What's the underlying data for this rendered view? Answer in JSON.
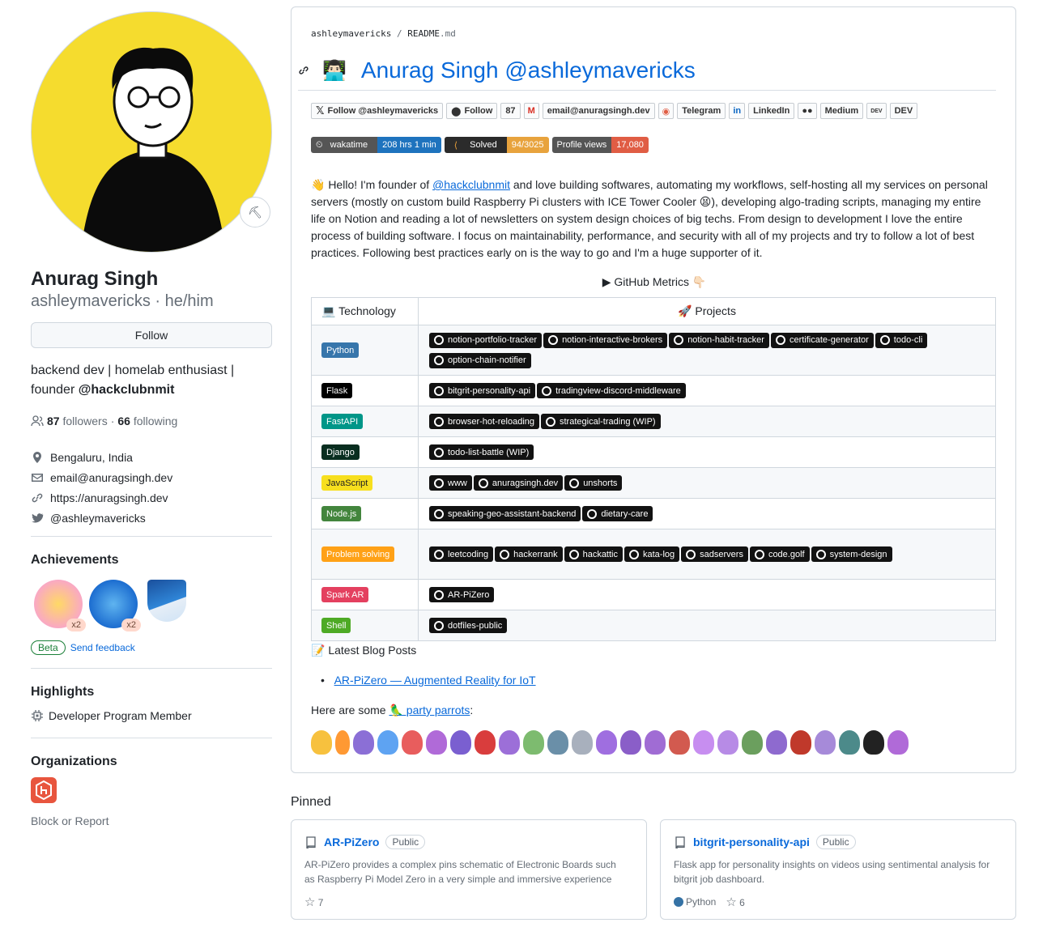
{
  "profile": {
    "name": "Anurag Singh",
    "login": "ashleymavericks",
    "pronouns": "he/him",
    "follow_label": "Follow",
    "bio_line1": "backend dev | homelab enthusiast |",
    "bio_line2_prefix": "founder ",
    "bio_line2_mention": "@hackclubnmit",
    "followers_count": "87",
    "followers_label": "followers",
    "following_count": "66",
    "following_label": "following",
    "location": "Bengaluru, India",
    "email": "email@anuragsingh.dev",
    "website": "https://anuragsingh.dev",
    "twitter": "@ashleymavericks",
    "achievements_title": "Achievements",
    "achievement_multiplier_1": "x2",
    "achievement_multiplier_2": "x2",
    "beta_label": "Beta",
    "feedback_label": "Send feedback",
    "highlights_title": "Highlights",
    "highlight_item": "Developer Program Member",
    "organizations_title": "Organizations",
    "block_label": "Block or Report"
  },
  "readme": {
    "breadcrumb_user": "ashleymavericks",
    "breadcrumb_sep": "/",
    "breadcrumb_file": "README",
    "breadcrumb_ext": ".md",
    "heading": "Anurag Singh @ashleymavericks",
    "social_badges": [
      "Follow @ashleymavericks",
      "Follow",
      "87",
      "email@anuragsingh.dev",
      "Telegram",
      "LinkedIn",
      "Medium",
      "DEV"
    ],
    "stat_badges": [
      {
        "label": "wakatime",
        "value": "208 hrs 1 min",
        "label_color": "#555555",
        "value_color": "#1e73be"
      },
      {
        "label": "Solved",
        "value": "94/3025",
        "label_color": "#2b2b2b",
        "value_color": "#e8a33d"
      },
      {
        "label": "Profile views",
        "value": "17,080",
        "label_color": "#555555",
        "value_color": "#e05d44"
      }
    ],
    "intro_before": "👋 Hello! I'm founder of ",
    "intro_link": "@hackclubnmit",
    "intro_after": " and love building softwares, automating my workflows, self-hosting all my services on personal servers (mostly on custom build Raspberry Pi clusters with ICE Tower Cooler 😫), developing algo-trading scripts, managing my entire life on Notion and reading a lot of newsletters on system design choices of big techs. From design to development I love the entire process of building software. I focus on maintainability, performance, and security with all of my projects and try to follow a lot of best practices. Following best practices early on is the way to go and I'm a huge supporter of it.",
    "metrics_label": "▶ GitHub Metrics 👇🏻",
    "table_headers": [
      "💻 Technology",
      "🚀 Projects"
    ],
    "table_rows": [
      {
        "tech": "Python",
        "color": "#3776AB",
        "projects": [
          "notion-portfolio-tracker",
          "notion-interactive-brokers",
          "notion-habit-tracker",
          "certificate-generator",
          "todo-cli",
          "option-chain-notifier"
        ]
      },
      {
        "tech": "Flask",
        "color": "#000000",
        "projects": [
          "bitgrit-personality-api",
          "tradingview-discord-middleware"
        ]
      },
      {
        "tech": "FastAPI",
        "color": "#009688",
        "projects": [
          "browser-hot-reloading",
          "strategical-trading (WIP)"
        ]
      },
      {
        "tech": "Django",
        "color": "#092E20",
        "projects": [
          "todo-list-battle (WIP)"
        ]
      },
      {
        "tech": "JavaScript",
        "color": "#F7DF1E",
        "projects": [
          "www",
          "anuragsingh.dev",
          "unshorts"
        ]
      },
      {
        "tech": "Node.js",
        "color": "#43853D",
        "projects": [
          "speaking-geo-assistant-backend",
          "dietary-care"
        ]
      },
      {
        "tech": "Problem solving",
        "color": "#FFA116",
        "projects": [
          "leetcoding",
          "hackerrank",
          "hackattic",
          "kata-log",
          "sadservers",
          "code.golf",
          "system-design"
        ]
      },
      {
        "tech": "Spark AR",
        "color": "#E4405F",
        "projects": [
          "AR-PiZero"
        ]
      },
      {
        "tech": "Shell",
        "color": "#4EAA25",
        "projects": [
          "dotfiles-public"
        ]
      }
    ],
    "blog_heading": "📝 Latest Blog Posts",
    "blog_post": "AR-PiZero — Augmented Reality for IoT",
    "parrots_prefix": "Here are some ",
    "parrots_link": "🦜 party parrots",
    "parrots_suffix": ":"
  },
  "pinned": {
    "title": "Pinned",
    "repos": [
      {
        "name": "AR-PiZero",
        "visibility": "Public",
        "description": "AR-PiZero provides a complex pins schematic of Electronic Boards such as Raspberry Pi Model Zero in a very simple and immersive experience",
        "stars": "7",
        "language": ""
      },
      {
        "name": "bitgrit-personality-api",
        "visibility": "Public",
        "description": "Flask app for personality insights on videos using sentimental analysis for bitgrit job dashboard.",
        "stars": "6",
        "language": "Python"
      }
    ]
  },
  "colors": {
    "link": "#0969da",
    "avatar_bg": "#f5dc2e"
  }
}
